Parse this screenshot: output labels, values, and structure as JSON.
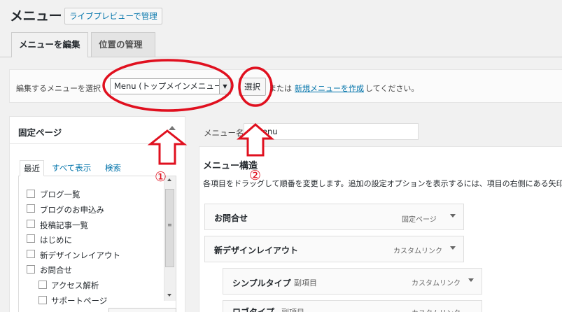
{
  "header": {
    "title": "メニュー",
    "live_preview_button": "ライブプレビューで管理"
  },
  "tabs": [
    {
      "label": "メニューを編集",
      "active": true
    },
    {
      "label": "位置の管理",
      "active": false
    }
  ],
  "select_bar": {
    "label": "編集するメニューを選択",
    "selected_menu": "Menu (トップメインメニュー)",
    "select_button": "選択",
    "or_text": "または",
    "new_menu_link": "新規メニューを作成",
    "after_text": "してください。"
  },
  "left_panel": {
    "title": "固定ページ",
    "tabs": [
      "最近",
      "すべて表示",
      "検索"
    ],
    "items": [
      {
        "label": "ブログ一覧",
        "level": 0
      },
      {
        "label": "ブログのお申込み",
        "level": 0
      },
      {
        "label": "投稿記事一覧",
        "level": 0
      },
      {
        "label": "はじめに",
        "level": 0
      },
      {
        "label": "新デザインレイアウト",
        "level": 0
      },
      {
        "label": "お問合せ",
        "level": 0
      },
      {
        "label": "アクセス解析",
        "level": 1
      },
      {
        "label": "サポートページ",
        "level": 1
      }
    ]
  },
  "right_panel": {
    "name_label": "メニュー名",
    "name_value": "Menu",
    "structure_title": "メニュー構造",
    "structure_desc": "各項目をドラッグして順番を変更します。追加の設定オプションを表示するには、項目の右側にある矢印",
    "menu_items": [
      {
        "title": "お問合せ",
        "sub": "",
        "type": "固定ページ"
      },
      {
        "title": "新デザインレイアウト",
        "sub": "",
        "type": "カスタムリンク"
      },
      {
        "title": "シンプルタイプ",
        "sub": "副項目",
        "type": "カスタムリンク"
      },
      {
        "title": "ロゴタイプ",
        "sub": "副項目",
        "type": "カスタムリンク"
      }
    ]
  },
  "annotations": {
    "marker_1": "①",
    "marker_2": "②",
    "color": "#e0101f"
  },
  "colors": {
    "link": "#0073aa",
    "background": "#f1f1f1"
  }
}
